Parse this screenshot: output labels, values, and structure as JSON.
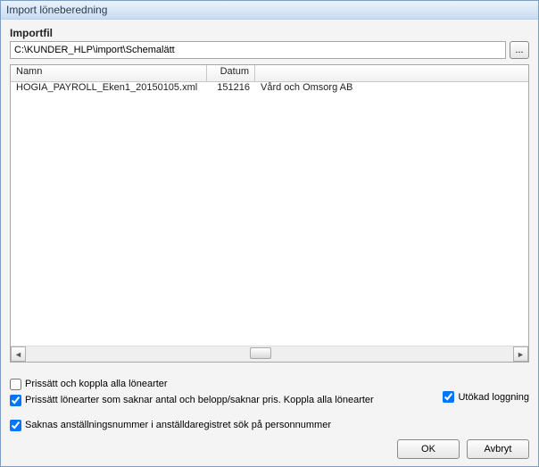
{
  "window": {
    "title": "Import löneberedning"
  },
  "importfil": {
    "label": "Importfil",
    "path": "C:\\KUNDER_HLP\\import\\Schemalätt",
    "browse_label": "..."
  },
  "table": {
    "headers": {
      "namn": "Namn",
      "datum": "Datum",
      "ftg": ""
    },
    "rows": [
      {
        "namn": "HOGIA_PAYROLL_Eken1_20150105.xml",
        "datum": "151216",
        "ftg": "Vård och Omsorg AB"
      }
    ]
  },
  "options": {
    "prissatt_alla": {
      "label": "Prissätt och koppla alla lönearter",
      "checked": false
    },
    "prissatt_saknar": {
      "label": "Prissätt lönearter som saknar antal och belopp/saknar pris. Koppla alla lönearter",
      "checked": true
    },
    "utokad_loggning": {
      "label": "Utökad loggning",
      "checked": true
    },
    "saknas_anst": {
      "label": "Saknas anställningsnummer i anställdaregistret sök på personnummer",
      "checked": true
    }
  },
  "buttons": {
    "ok": "OK",
    "cancel": "Avbryt"
  }
}
